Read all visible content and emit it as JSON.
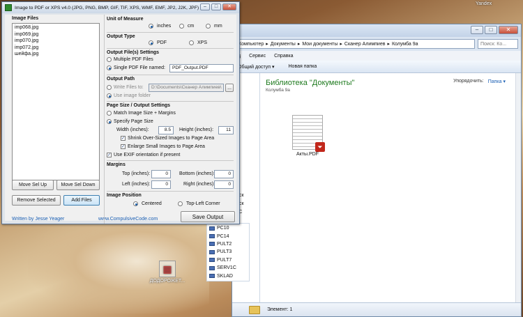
{
  "desktop": {
    "top_right_label": "Yandex",
    "icon_label": "ДОДОРОЖЕТ..."
  },
  "explorer": {
    "address_parts": [
      "Компьютер",
      "Документы",
      "Мои документы",
      "Сканер Алимпиев",
      "Колумба 9а"
    ],
    "search_placeholder": "Поиск: Ко...",
    "menu": [
      "д",
      "Сервис",
      "Справка"
    ],
    "toolbar": [
      "Общий доступ ▾",
      "Новая папка"
    ],
    "library_title": "Библиотека \"Документы\"",
    "library_subtitle": "Колумба 9а",
    "arrange_label": "Упорядочить:",
    "arrange_value": "Папка ▾",
    "file_name": "Акты.PDF",
    "status_text": "Элемент: 1",
    "nav_fragments": [
      "кт",
      "к",
      "",
      "",
      "",
      "",
      "диск",
      "диск",
      "к (С"
    ],
    "network_items": [
      "PC10",
      "PC14",
      "PULT2",
      "PULT3",
      "PULT7",
      "SERV1C",
      "SKLAD"
    ]
  },
  "app": {
    "title": "Image to PDF or XPS  v4.0   (JPG, PNG, BMP, GIF, TIF, XPS, WMF, EMF, JP2, J2K, JPF)",
    "image_files_label": "Image Files",
    "files": [
      "imp068.jpg",
      "imp069.jpg",
      "imp070.jpg",
      "imp072.jpg",
      "шейфа.jpg"
    ],
    "move_up": "Move Sel Up",
    "move_down": "Move Sel Down",
    "remove_selected": "Remove Selected",
    "add_files": "Add Files",
    "author": "Written by Jesse Yeager",
    "website": "www.CompulsiveCode.com",
    "unit_label": "Unit of Measure",
    "unit_inches": "inches",
    "unit_cm": "cm",
    "unit_mm": "mm",
    "output_type_label": "Output Type",
    "type_pdf": "PDF",
    "type_xps": "XPS",
    "output_settings_label": "Output File(s) Settings",
    "multiple_pdf": "Multiple PDF Files",
    "single_pdf": "Single PDF File named:",
    "single_pdf_name": "PDF_Output.PDF",
    "output_path_label": "Output Path",
    "write_files_to": "Write Files to:",
    "path_value": "D:\\Documents\\Сканер Алимпиев\\",
    "browse": "...",
    "use_image_folder": "Use image folder",
    "page_size_label": "Page Size / Output Settings",
    "match_image": "Match Image Size + Margins",
    "specify_page": "Specify Page Size",
    "width_label": "Width (inches):",
    "width_value": "8.5",
    "height_label": "Height (inches):",
    "height_value": "11",
    "shrink": "Shrink Over-Sized Images to Page Area",
    "enlarge": "Enlarge Small Images to Page Area",
    "exif": "Use EXIF orientation if present",
    "margins_label": "Margins",
    "top_label": "Top (inches):",
    "top_value": "0",
    "bottom_label": "Bottom (inches):",
    "bottom_value": "0",
    "left_label": "Left (inches):",
    "left_value": "0",
    "right_label": "Right (inches):",
    "right_value": "0",
    "position_label": "Image Position",
    "pos_centered": "Centered",
    "pos_topleft": "Top-Left Corner",
    "save_output": "Save Output"
  }
}
